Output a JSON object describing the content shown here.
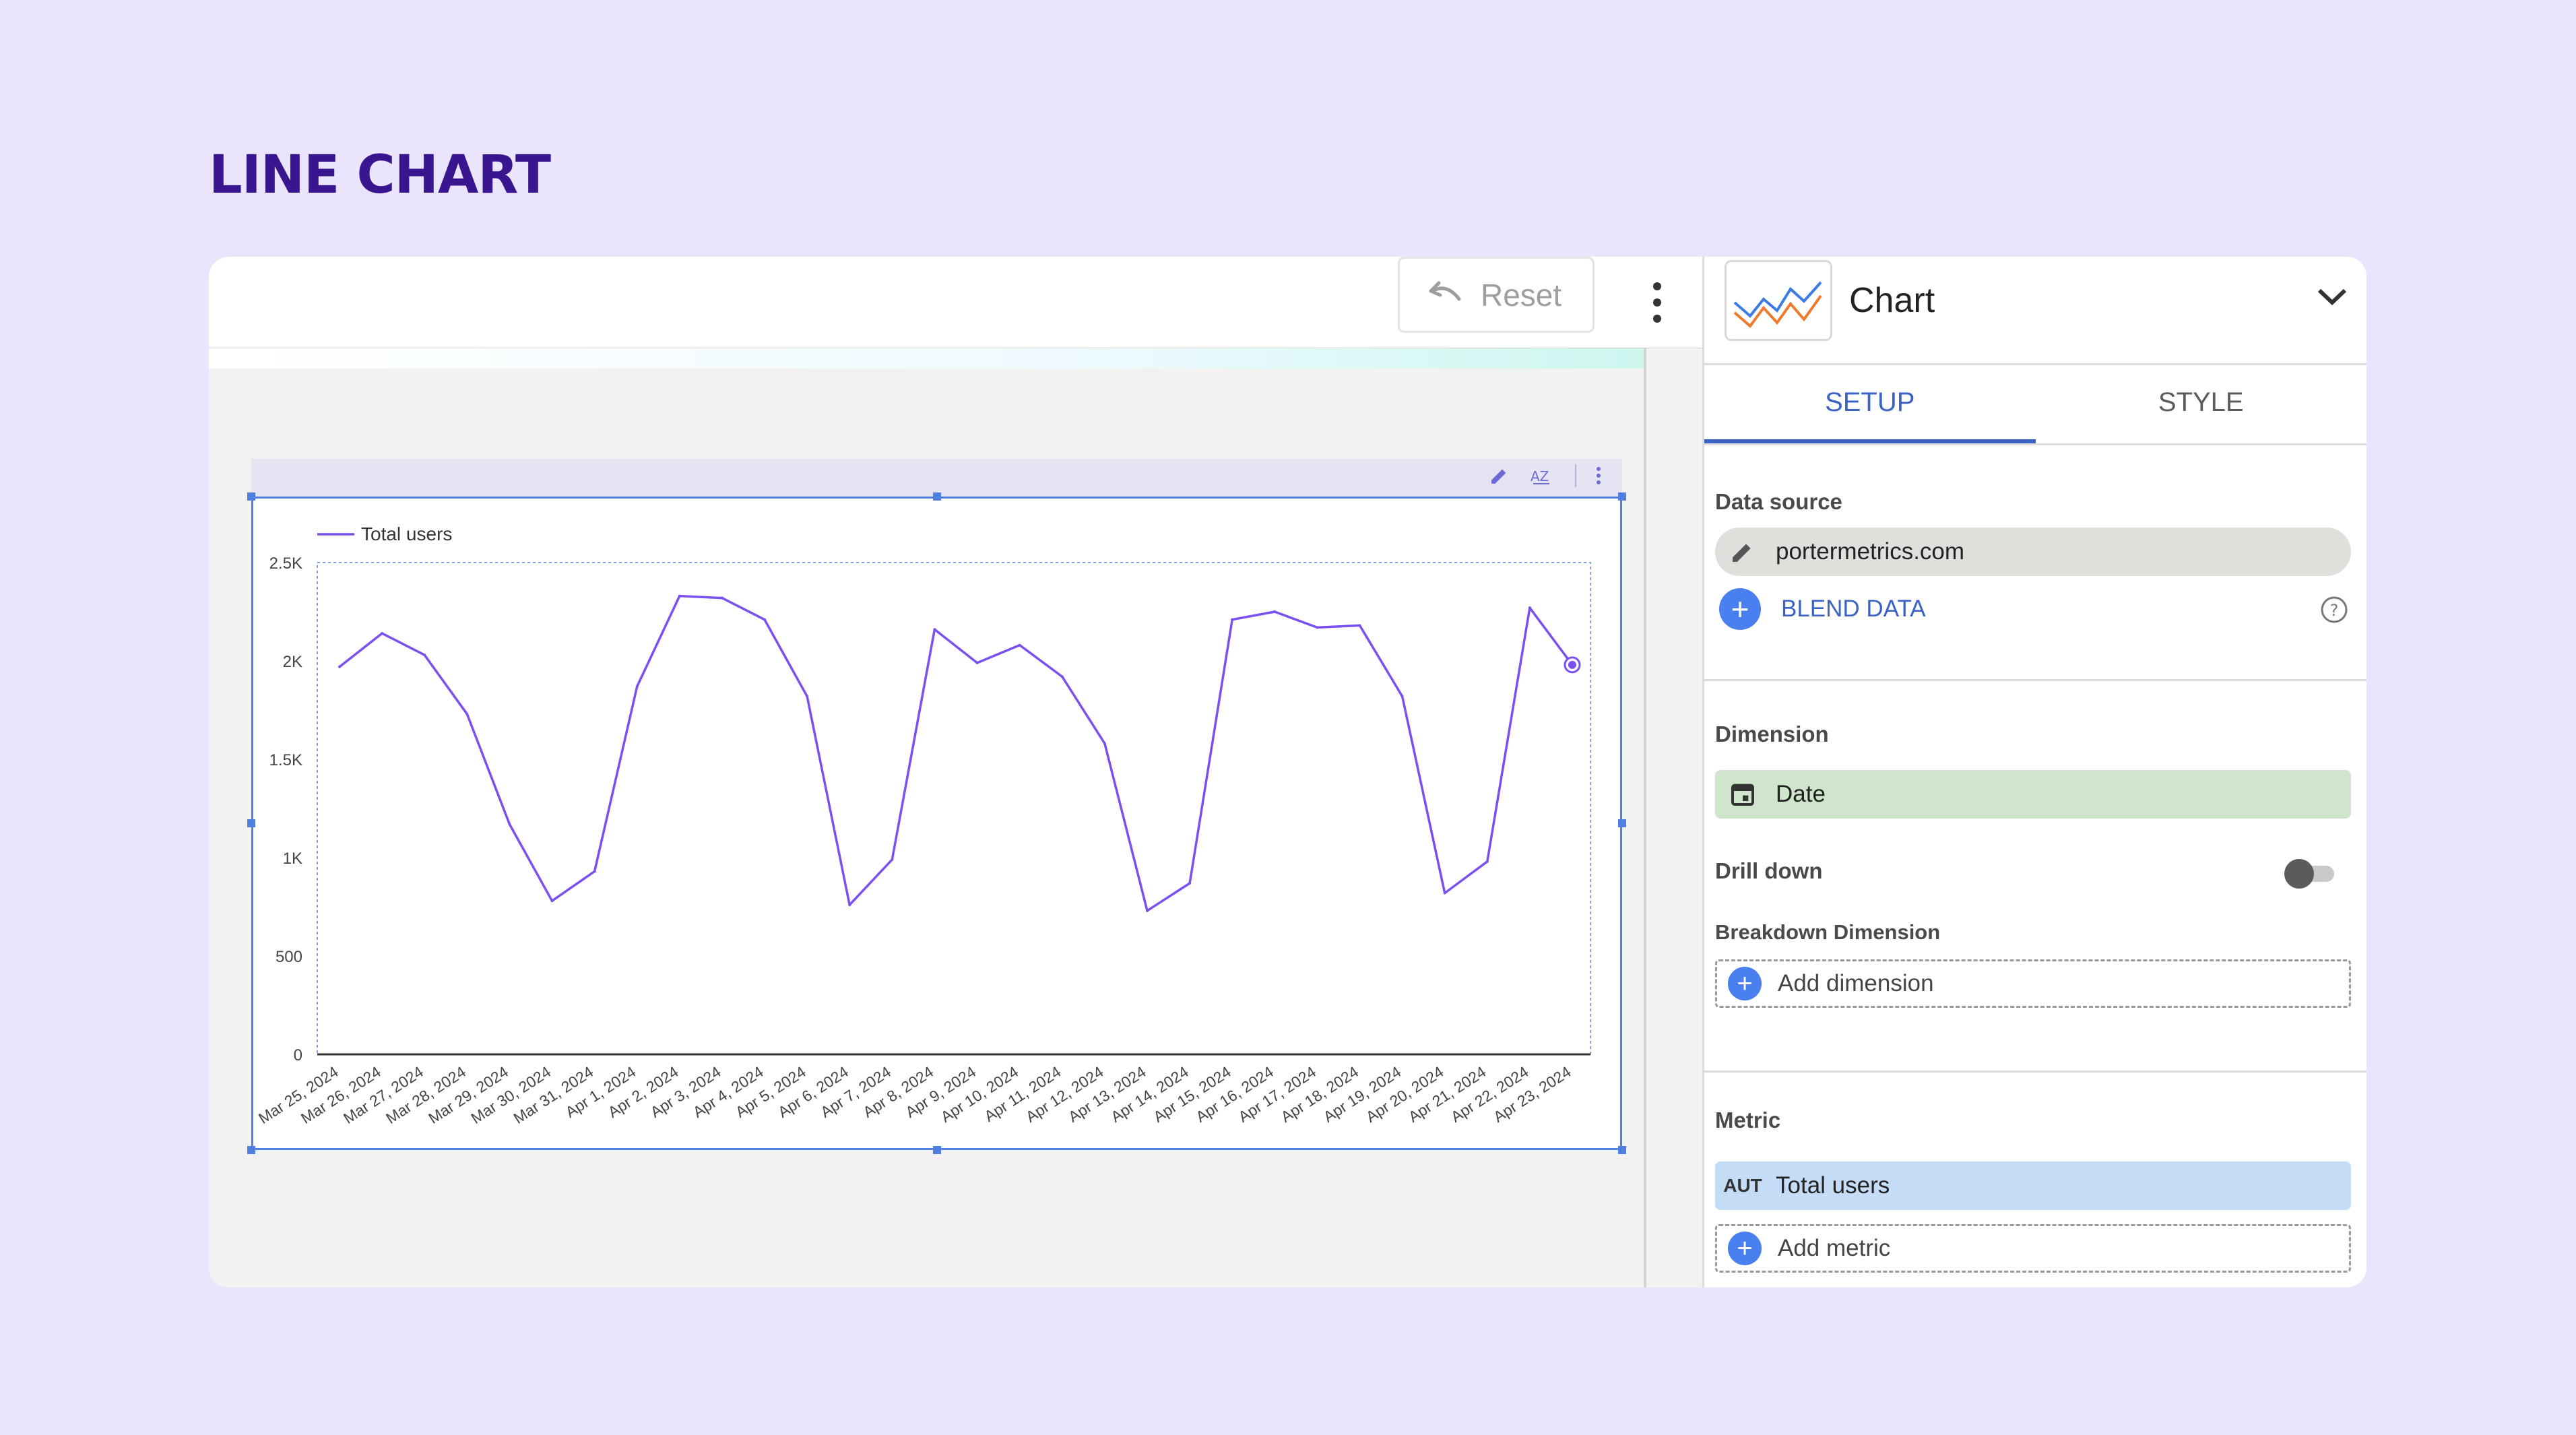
{
  "page": {
    "title": "LINE CHART"
  },
  "toolbar": {
    "reset_label": "Reset"
  },
  "chart_data": {
    "type": "line",
    "title": "",
    "xlabel": "",
    "ylabel": "",
    "ylim": [
      0,
      2500
    ],
    "yticks": [
      "0",
      "500",
      "1K",
      "1.5K",
      "2K",
      "2.5K"
    ],
    "ytick_values": [
      0,
      500,
      1000,
      1500,
      2000,
      2500
    ],
    "legend_position": "top-left",
    "grid": false,
    "categories": [
      "Mar 25, 2024",
      "Mar 26, 2024",
      "Mar 27, 2024",
      "Mar 28, 2024",
      "Mar 29, 2024",
      "Mar 30, 2024",
      "Mar 31, 2024",
      "Apr 1, 2024",
      "Apr 2, 2024",
      "Apr 3, 2024",
      "Apr 4, 2024",
      "Apr 5, 2024",
      "Apr 6, 2024",
      "Apr 7, 2024",
      "Apr 8, 2024",
      "Apr 9, 2024",
      "Apr 10, 2024",
      "Apr 11, 2024",
      "Apr 12, 2024",
      "Apr 13, 2024",
      "Apr 14, 2024",
      "Apr 15, 2024",
      "Apr 16, 2024",
      "Apr 17, 2024",
      "Apr 18, 2024",
      "Apr 19, 2024",
      "Apr 20, 2024",
      "Apr 21, 2024",
      "Apr 22, 2024",
      "Apr 23, 2024"
    ],
    "series": [
      {
        "name": "Total users",
        "color": "#7b4ff0",
        "values": [
          1970,
          2140,
          2030,
          1730,
          1170,
          780,
          930,
          1870,
          2330,
          2320,
          2210,
          1820,
          760,
          990,
          2160,
          1990,
          2080,
          1920,
          1580,
          730,
          870,
          2210,
          2250,
          2170,
          2180,
          1820,
          820,
          980,
          2270,
          1980
        ]
      }
    ]
  },
  "panel": {
    "title": "Chart",
    "tabs": {
      "setup": "SETUP",
      "style": "STYLE"
    },
    "data_source": {
      "label": "Data source",
      "value": "portermetrics.com",
      "blend": "BLEND DATA"
    },
    "dimension": {
      "label": "Dimension",
      "value": "Date"
    },
    "drill_down": {
      "label": "Drill down"
    },
    "breakdown": {
      "label": "Breakdown Dimension",
      "add": "Add dimension"
    },
    "metric": {
      "label": "Metric",
      "badge": "AUT",
      "value": "Total users",
      "add": "Add metric"
    }
  }
}
